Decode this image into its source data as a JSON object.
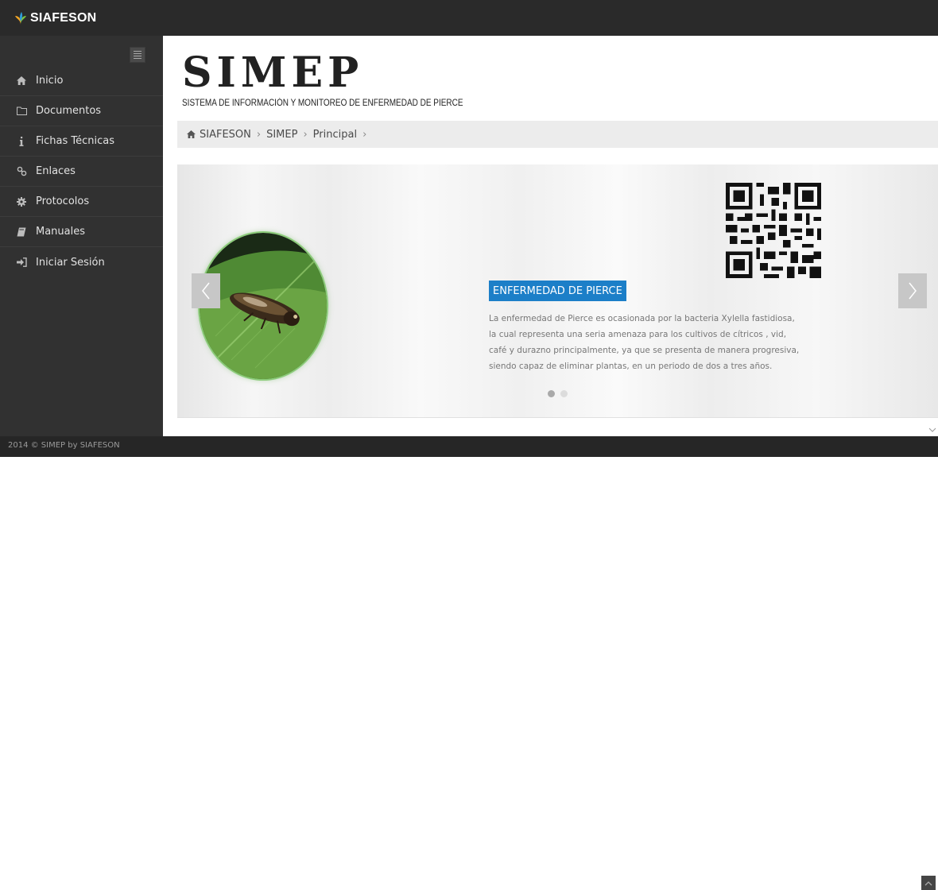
{
  "brand": {
    "name": "SIAFESON",
    "logo_icon": "siafeson-leaf-icon"
  },
  "header": {
    "title": "SIMEP",
    "subtitle": "SISTEMA DE INFORMACIÓN Y MONITOREO DE ENFERMEDAD DE PIERCE"
  },
  "sidebar": {
    "toggle_icon": "menu-lines-icon",
    "items": [
      {
        "label": "Inicio",
        "icon": "home-icon"
      },
      {
        "label": "Documentos",
        "icon": "folder-icon"
      },
      {
        "label": "Fichas Técnicas",
        "icon": "info-icon"
      },
      {
        "label": "Enlaces",
        "icon": "link-icon"
      },
      {
        "label": "Protocolos",
        "icon": "cog-icon"
      },
      {
        "label": "Manuales",
        "icon": "book-icon"
      },
      {
        "label": "Iniciar Sesión",
        "icon": "sign-in-icon"
      }
    ]
  },
  "breadcrumb": {
    "items": [
      "SIAFESON",
      "SIMEP",
      "Principal"
    ],
    "separator": "›"
  },
  "carousel": {
    "slide_title": "ENFERMEDAD DE PIERCE",
    "slide_lines": [
      "La enfermedad de Pierce es ocasionada por la bacteria Xylella fastidiosa,",
      "la cual representa una seria amenaza para los cultivos de cítricos , vid,",
      "café y durazno principalmente, ya que se presenta de manera progresiva,",
      "siendo capaz de eliminar plantas, en un periodo de dos a tres años."
    ],
    "active_slide": 1,
    "slide_count": 2
  },
  "footer": {
    "copyright": "2014 © SIMEP by SIAFESON"
  },
  "colors": {
    "topbar": "#2a2a2a",
    "sidebar": "#313131",
    "accent": "#1c7fc8",
    "breadcrumb_bg": "#ececec"
  }
}
